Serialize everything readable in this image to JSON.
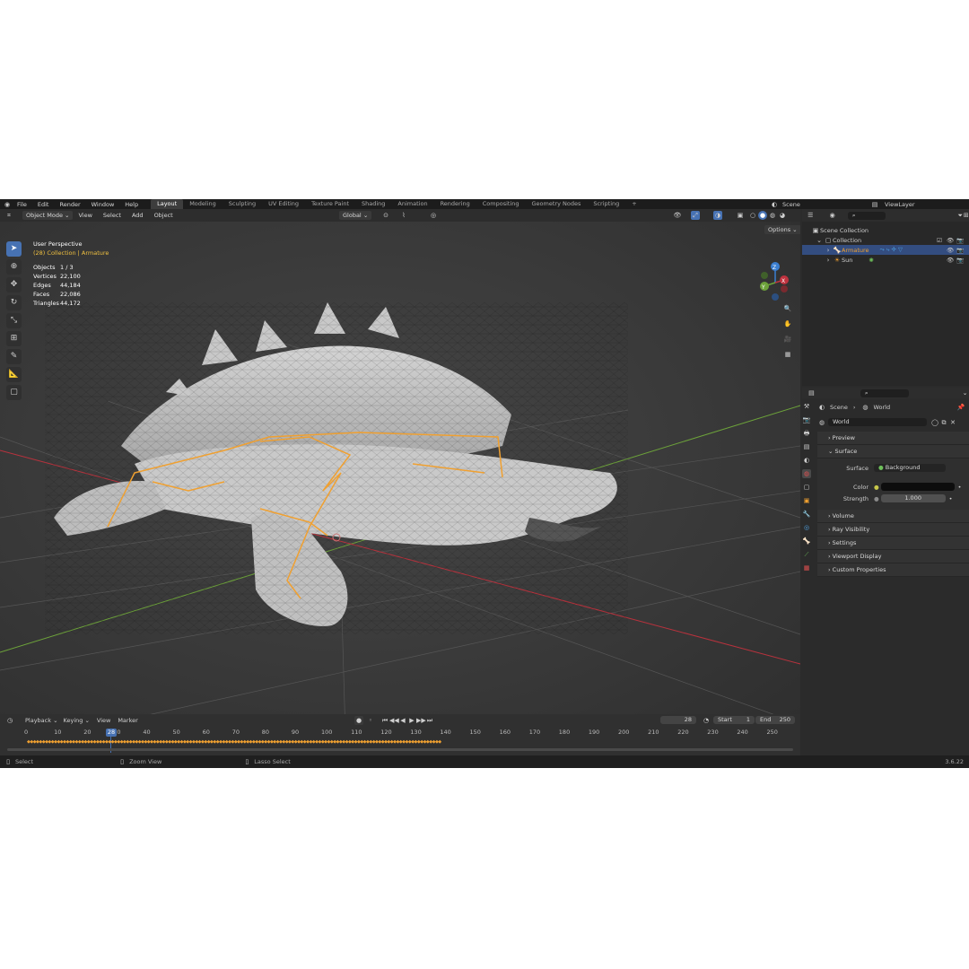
{
  "menu": [
    "File",
    "Edit",
    "Render",
    "Window",
    "Help"
  ],
  "workspaces": [
    "Layout",
    "Modeling",
    "Sculpting",
    "UV Editing",
    "Texture Paint",
    "Shading",
    "Animation",
    "Rendering",
    "Compositing",
    "Geometry Nodes",
    "Scripting"
  ],
  "active_workspace": "Layout",
  "add_workspace": "+",
  "scene_name": "Scene",
  "view_layer": "ViewLayer",
  "viewport_header": {
    "mode": "Object Mode",
    "view": "View",
    "select": "Select",
    "add": "Add",
    "object": "Object",
    "transform_orientation": "Global",
    "options": "Options"
  },
  "overlay": {
    "perspective": "User Perspective",
    "collection": "(28) Collection | Armature",
    "stats": [
      {
        "label": "Objects",
        "value": "1 / 3"
      },
      {
        "label": "Vertices",
        "value": "22,100"
      },
      {
        "label": "Edges",
        "value": "44,184"
      },
      {
        "label": "Faces",
        "value": "22,086"
      },
      {
        "label": "Triangles",
        "value": "44,172"
      }
    ]
  },
  "gizmo_axes": {
    "z": "Z",
    "y": "Y",
    "x": "X"
  },
  "outliner": {
    "scene_collection": "Scene Collection",
    "collection": "Collection",
    "items": [
      {
        "name": "Armature",
        "selected": true
      },
      {
        "name": "Sun",
        "selected": false
      }
    ]
  },
  "properties": {
    "breadcrumb_scene": "Scene",
    "breadcrumb_world": "World",
    "world_name": "World",
    "panels": {
      "preview": "Preview",
      "surface": "Surface",
      "volume": "Volume",
      "ray_visibility": "Ray Visibility",
      "settings": "Settings",
      "viewport_display": "Viewport Display",
      "custom_properties": "Custom Properties"
    },
    "surface_label": "Surface",
    "surface_value": "Background",
    "color_label": "Color",
    "color_value": "#0d0d0d",
    "strength_label": "Strength",
    "strength_value": "1.000"
  },
  "timeline": {
    "playback": "Playback",
    "keying": "Keying",
    "view": "View",
    "marker": "Marker",
    "current_frame": "28",
    "start_label": "Start",
    "start": "1",
    "end_label": "End",
    "end": "250",
    "ticks": [
      "0",
      "10",
      "20",
      "30",
      "40",
      "50",
      "60",
      "70",
      "80",
      "90",
      "100",
      "110",
      "120",
      "130",
      "140",
      "150",
      "160",
      "170",
      "180",
      "190",
      "200",
      "210",
      "220",
      "230",
      "240",
      "250"
    ],
    "playhead_label": "28"
  },
  "statusbar": {
    "select": "Select",
    "zoom": "Zoom View",
    "lasso": "Lasso Select",
    "version": "3.6.22"
  },
  "colors": {
    "accent": "#4772b3",
    "bone": "#f0a030",
    "mesh": "#bdbdbd",
    "x_axis": "#c0333f",
    "y_axis": "#6da33a",
    "z_axis": "#3b7fd1"
  }
}
